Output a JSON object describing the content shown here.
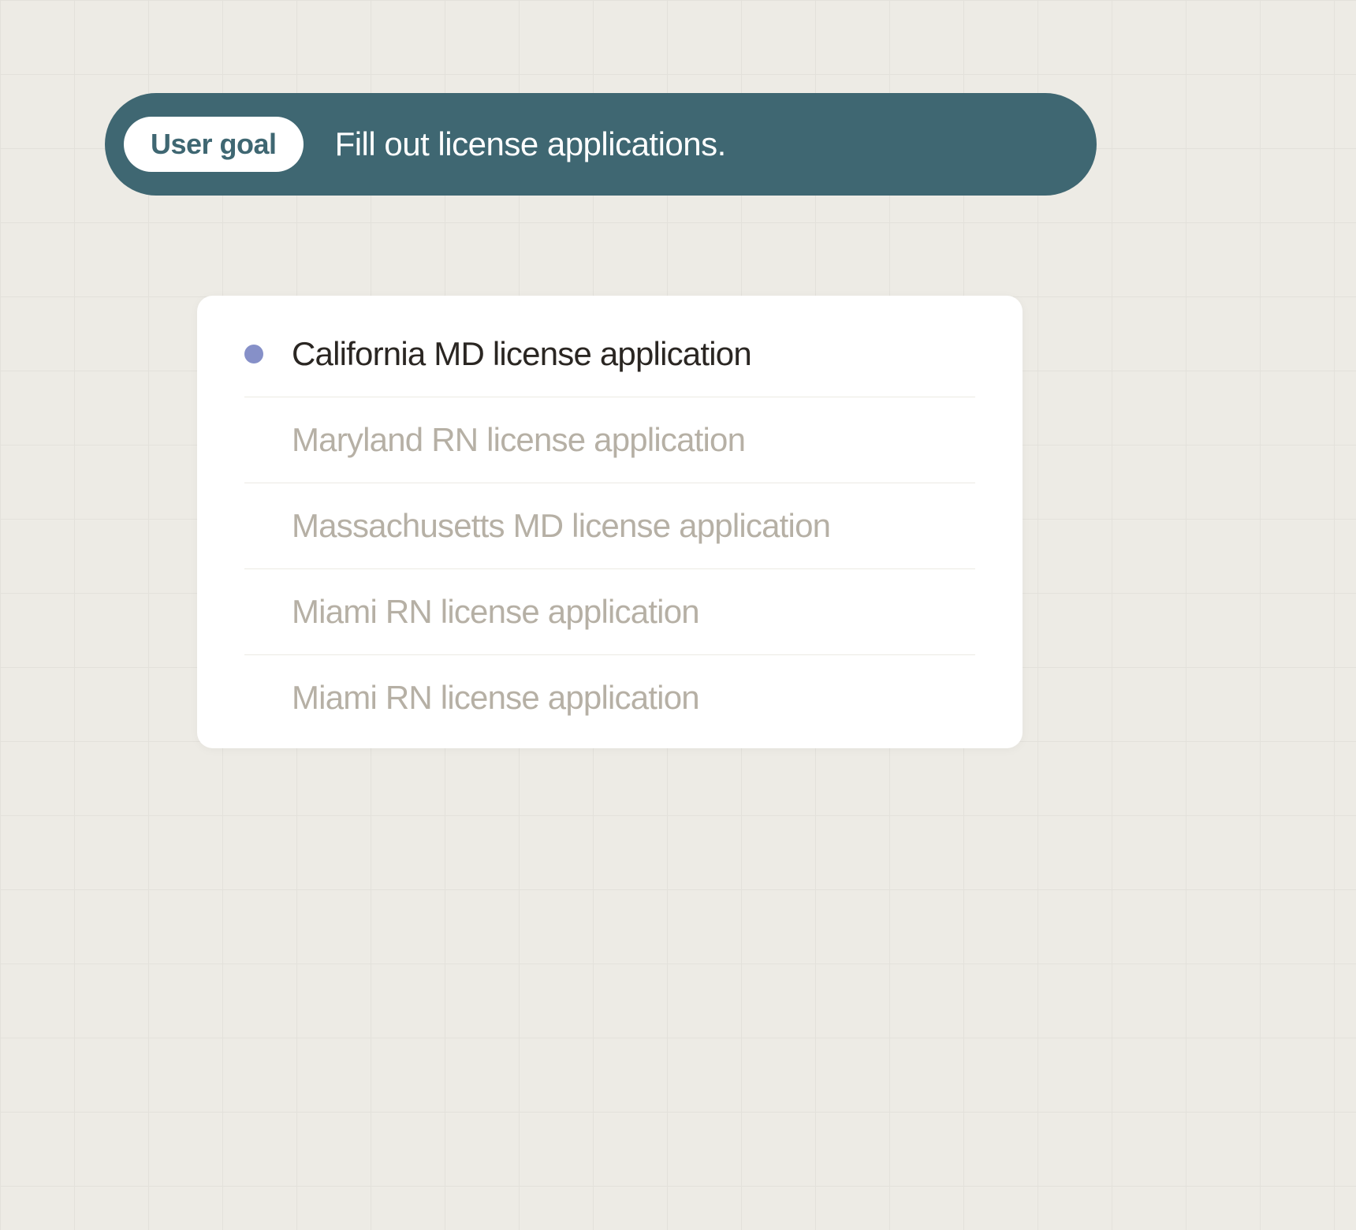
{
  "header": {
    "badge_label": "User goal",
    "goal_text": "Fill out license applications."
  },
  "list": {
    "items": [
      {
        "label": "California MD license application",
        "active": true
      },
      {
        "label": "Maryland RN license application",
        "active": false
      },
      {
        "label": "Massachusetts MD license application",
        "active": false
      },
      {
        "label": "Miami RN license application",
        "active": false
      },
      {
        "label": "Miami RN license application",
        "active": false
      }
    ]
  },
  "colors": {
    "header_bg": "#3f6772",
    "bullet": "#8690c8",
    "active_text": "#2a2622",
    "inactive_text": "#b6b0a5",
    "page_bg": "#edebe5"
  }
}
